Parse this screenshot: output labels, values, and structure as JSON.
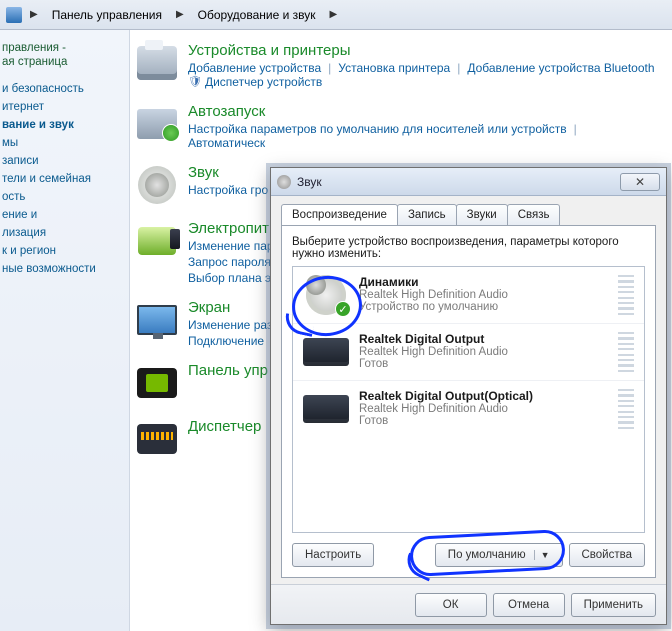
{
  "breadcrumb": {
    "item1": "Панель управления",
    "item2": "Оборудование и звук"
  },
  "sidebar": {
    "header1": "правления -",
    "header2": "ая страница",
    "items": [
      "и безопасность",
      "итернет",
      "вание и звук",
      "мы",
      "записи",
      "тели и семейная",
      "ость",
      "ение и",
      "лизация",
      "к и регион",
      "ные возможности"
    ],
    "active_index": 2
  },
  "categories": [
    {
      "title": "Устройства и принтеры",
      "links": [
        "Добавление устройства",
        "Установка принтера",
        "Добавление устройства Bluetooth"
      ],
      "extra_with_shield": "Диспетчер устройств"
    },
    {
      "title": "Автозапуск",
      "links": [
        "Настройка параметров по умолчанию для носителей или устройств"
      ],
      "cut": "Автоматическ"
    },
    {
      "title": "Звук",
      "links": [
        "Настройка гро"
      ]
    },
    {
      "title": "Электропит",
      "links": [
        "Изменение пар",
        "Запрос пароля",
        "Выбор плана э"
      ]
    },
    {
      "title": "Экран",
      "links": [
        "Изменение раз",
        "Подключение"
      ]
    },
    {
      "title": "Панель упр",
      "links": []
    },
    {
      "title": "Диспетчер",
      "links": []
    }
  ],
  "dialog": {
    "title": "Звук",
    "tabs": [
      "Воспроизведение",
      "Запись",
      "Звуки",
      "Связь"
    ],
    "instruction": "Выберите устройство воспроизведения, параметры которого нужно изменить:",
    "devices": [
      {
        "name": "Динамики",
        "sub": "Realtek High Definition Audio",
        "status": "Устройство по умолчанию",
        "default": true,
        "kind": "speaker"
      },
      {
        "name": "Realtek Digital Output",
        "sub": "Realtek High Definition Audio",
        "status": "Готов",
        "default": false,
        "kind": "device"
      },
      {
        "name": "Realtek Digital Output(Optical)",
        "sub": "Realtek High Definition Audio",
        "status": "Готов",
        "default": false,
        "kind": "device"
      }
    ],
    "btn_configure": "Настроить",
    "btn_default": "По умолчанию",
    "btn_properties": "Свойства",
    "btn_ok": "ОК",
    "btn_cancel": "Отмена",
    "btn_apply": "Применить"
  }
}
